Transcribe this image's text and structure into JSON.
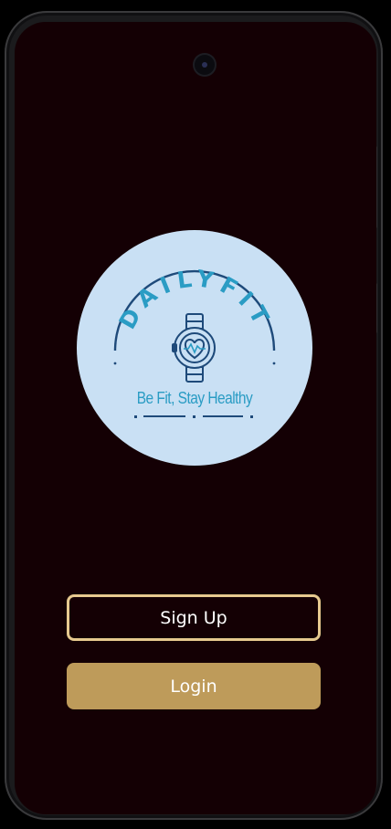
{
  "logo": {
    "brand": "DAILYFIT",
    "tagline": "Be Fit, Stay Healthy",
    "icon": "smartwatch-heart-icon"
  },
  "buttons": {
    "signup_label": "Sign Up",
    "login_label": "Login"
  },
  "colors": {
    "screen_background": "#140004",
    "logo_background": "#c9e0f4",
    "logo_teal": "#2a9cc4",
    "logo_navy": "#1e4a7a",
    "signup_border": "#e6c98f",
    "login_fill": "#be9b5a"
  }
}
